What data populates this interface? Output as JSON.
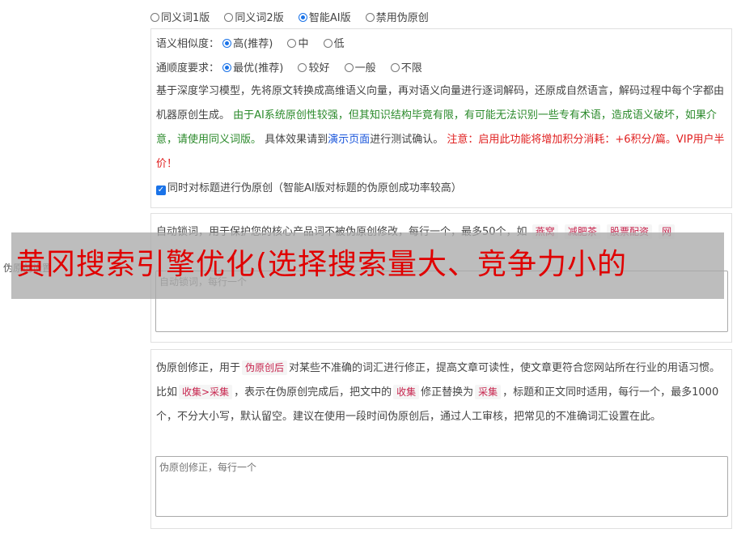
{
  "mode_options": [
    {
      "label": "同义词1版",
      "selected": false
    },
    {
      "label": "同义词2版",
      "selected": false
    },
    {
      "label": "智能AI版",
      "selected": true
    },
    {
      "label": "禁用伪原创",
      "selected": false
    }
  ],
  "similarity": {
    "label": "语义相似度：",
    "options": [
      {
        "label": "高(推荐)",
        "selected": true
      },
      {
        "label": "中",
        "selected": false
      },
      {
        "label": "低",
        "selected": false
      }
    ]
  },
  "fluency": {
    "label": "通顺度要求：",
    "options": [
      {
        "label": "最优(推荐)",
        "selected": true
      },
      {
        "label": "较好",
        "selected": false
      },
      {
        "label": "一般",
        "selected": false
      },
      {
        "label": "不限",
        "selected": false
      }
    ]
  },
  "ai_desc": {
    "part1": "基于深度学习模型，先将原文转换成高维语义向量，再对语义向量进行逐词解码，还原成自然语言，解码过程中每个字都由机器原创生成。",
    "green": "由于AI系统原创性较强，但其知识结构毕竟有限，有可能无法识别一些专有术语，造成语义破坏，如果介意，请使用同义词版。",
    "part2": "具体效果请到",
    "link": "演示页面",
    "part3": "进行测试确认。",
    "red": "注意：启用此功能将增加积分消耗：+6积分/篇。VIP用户半价！"
  },
  "title_option": {
    "label": "同时对标题进行伪原创（智能AI版对标题的伪原创成功率较高）",
    "checked": true
  },
  "lock_words": {
    "desc_prefix": "自动锁词，用于保护您的核心产品词不被伪原创修改，每行一个，最多50个，如",
    "examples": [
      "燕窝",
      "减肥茶",
      "股票配资",
      "网"
    ],
    "placeholder": "自动锁词，每行一个"
  },
  "side_label": "伪原创设置",
  "fix": {
    "desc_1": "伪原创修正，用于",
    "tag_1": "伪原创后",
    "desc_2": "对某些不准确的词汇进行修正，提高文章可读性，使文章更符合您网站所在行业的用语习惯。比如",
    "tag_2": "收集>采集",
    "desc_3": "，表示在伪原创完成后，把文中的",
    "tag_3": "收集",
    "desc_4": "修正替换为",
    "tag_4": "采集",
    "desc_5": "，标题和正文同时适用，每行一个，最多1000个，不分大小写，默认留空。建议在使用一段时间伪原创后，通过人工审核，把常见的不准确词汇设置在此。",
    "placeholder": "伪原创修正，每行一个"
  },
  "banner_text": "黄冈搜索引擎优化(选择搜索量大、竞争力小的"
}
